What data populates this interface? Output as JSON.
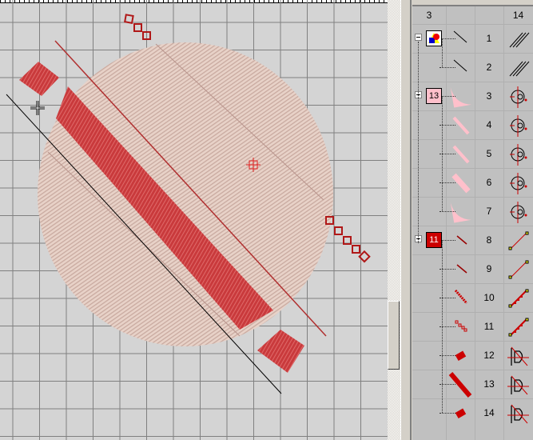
{
  "panel": {
    "columns": [
      "3",
      "",
      "",
      "14"
    ],
    "groups": [
      {
        "label": "",
        "icon": "multicolor-shapes-icon",
        "color": "#ffffff",
        "first_row": 0
      },
      {
        "label": "13",
        "color": "#ffc0cb",
        "first_row": 2
      },
      {
        "label": "11",
        "color": "#cc0000",
        "first_row": 7
      }
    ],
    "rows": [
      {
        "number": "1",
        "thumb": "line",
        "stitch": "hatch"
      },
      {
        "number": "2",
        "thumb": "line",
        "stitch": "hatch"
      },
      {
        "number": "3",
        "thumb": "pink-half-disc",
        "stitch": "circle-fill"
      },
      {
        "number": "4",
        "thumb": "pink-strip",
        "stitch": "circle-fill"
      },
      {
        "number": "5",
        "thumb": "pink-strip",
        "stitch": "circle-fill"
      },
      {
        "number": "6",
        "thumb": "pink-strip-wide",
        "stitch": "circle-fill"
      },
      {
        "number": "7",
        "thumb": "pink-half-disc",
        "stitch": "circle-fill"
      },
      {
        "number": "8",
        "thumb": "red-line",
        "stitch": "run"
      },
      {
        "number": "9",
        "thumb": "red-line",
        "stitch": "run"
      },
      {
        "number": "10",
        "thumb": "red-zigzag",
        "stitch": "triple-run"
      },
      {
        "number": "11",
        "thumb": "red-boxes",
        "stitch": "triple-run"
      },
      {
        "number": "12",
        "thumb": "red-diamond",
        "stitch": "satin-d"
      },
      {
        "number": "13",
        "thumb": "red-band",
        "stitch": "satin-d"
      },
      {
        "number": "14",
        "thumb": "red-diamond",
        "stitch": "satin-d"
      }
    ]
  },
  "colors": {
    "pink": "#e6cdc4",
    "red": "#c8383a",
    "canvas": "#d4d4d4",
    "grid": "#808080"
  }
}
